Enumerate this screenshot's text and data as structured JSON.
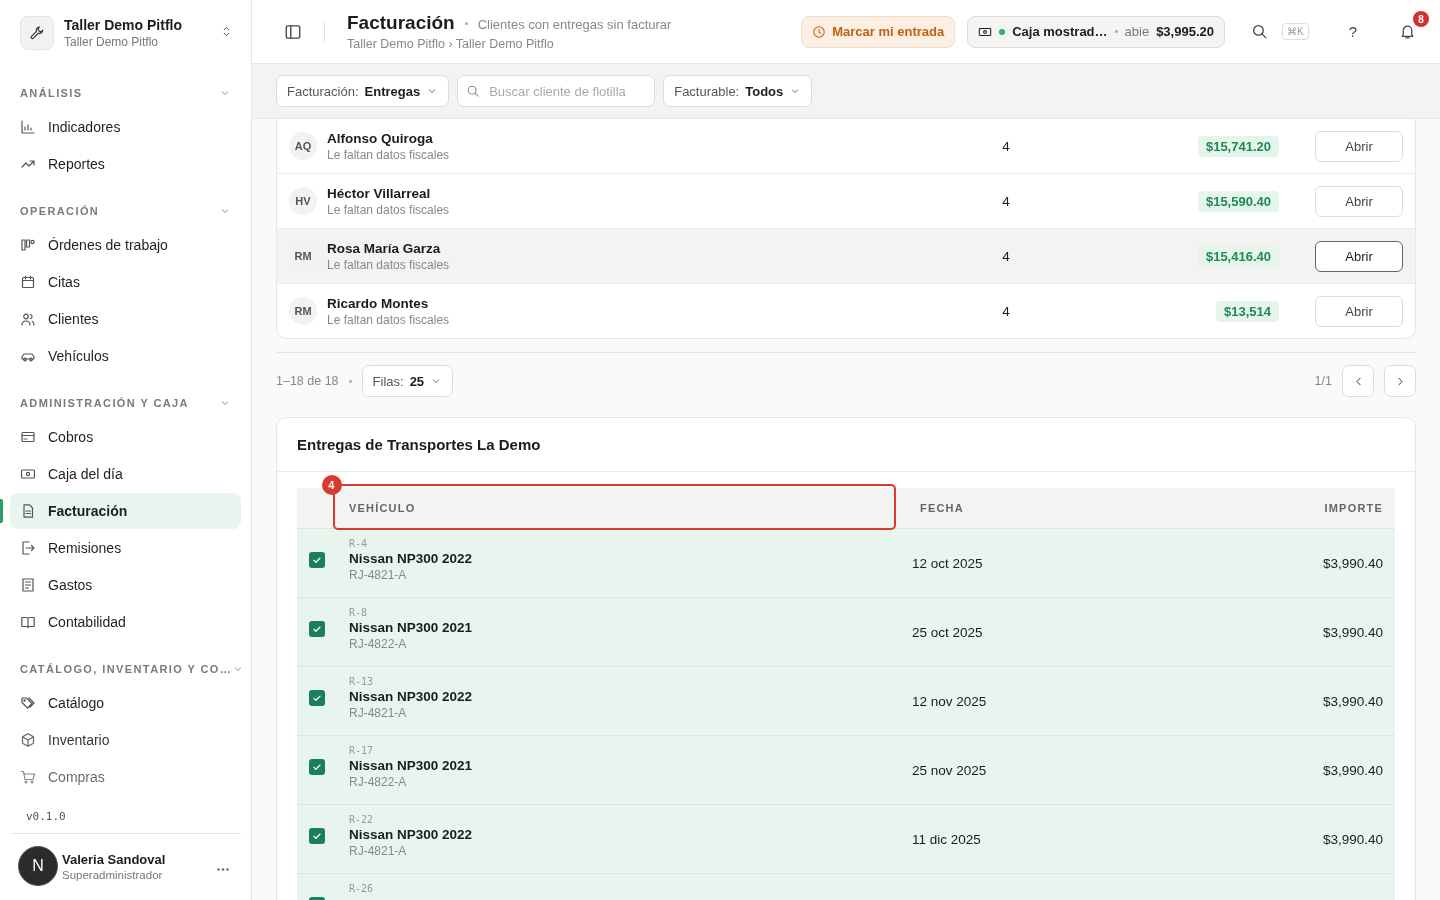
{
  "sidebar": {
    "workspace": {
      "name": "Taller Demo Pitflo",
      "subtitle": "Taller Demo Pitflo"
    },
    "sections": [
      {
        "label": "ANÁLISIS",
        "expanded": true,
        "items": [
          {
            "label": "Indicadores",
            "selected": false
          },
          {
            "label": "Reportes",
            "selected": false
          }
        ]
      },
      {
        "label": "OPERACIÓN",
        "expanded": true,
        "items": [
          {
            "label": "Órdenes de trabajo",
            "selected": false
          },
          {
            "label": "Citas",
            "selected": false
          },
          {
            "label": "Clientes",
            "selected": false
          },
          {
            "label": "Vehículos",
            "selected": false
          }
        ]
      },
      {
        "label": "ADMINISTRACIÓN Y CAJA",
        "expanded": true,
        "items": [
          {
            "label": "Cobros",
            "selected": false
          },
          {
            "label": "Caja del día",
            "selected": false
          },
          {
            "label": "Facturación",
            "selected": true
          },
          {
            "label": "Remisiones",
            "selected": false
          },
          {
            "label": "Gastos",
            "selected": false
          },
          {
            "label": "Contabilidad",
            "selected": false
          }
        ]
      },
      {
        "label": "CATÁLOGO, INVENTARIO Y CO…",
        "expanded": true,
        "items": [
          {
            "label": "Catálogo",
            "selected": false
          },
          {
            "label": "Inventario",
            "selected": false
          },
          {
            "label": "Compras",
            "selected": false
          }
        ]
      }
    ],
    "version": "v0.1.0",
    "user": {
      "initial": "N",
      "name": "Valeria Sandoval",
      "role": "Superadministrador"
    }
  },
  "header": {
    "title": "Facturación",
    "subtitle": "Clientes con entregas sin facturar",
    "breadcrumb": "Taller Demo Pitflo › Taller Demo Pitflo",
    "clock_in_button": "Marcar mi entrada",
    "register": {
      "name": "Caja mostrad…",
      "open": true,
      "status": "abie",
      "amount": "$3,995.20"
    },
    "shortcut": "⌘K",
    "help": "?",
    "notifications": "8"
  },
  "filters": {
    "billing": {
      "label": "Facturación:",
      "value": "Entregas"
    },
    "search": {
      "placeholder": "Buscar cliente de flotilla"
    },
    "billable": {
      "label": "Facturable:",
      "value": "Todos"
    }
  },
  "clients": [
    {
      "initials": "AQ",
      "name": "Alfonso Quiroga",
      "note": "Le faltan datos fiscales",
      "count": "4",
      "amount": "$15,741.20",
      "action": "Abrir",
      "hovered": false
    },
    {
      "initials": "HV",
      "name": "Héctor Villarreal",
      "note": "Le faltan datos fiscales",
      "count": "4",
      "amount": "$15,590.40",
      "action": "Abrir",
      "hovered": false
    },
    {
      "initials": "RM",
      "name": "Rosa María Garza",
      "note": "Le faltan datos fiscales",
      "count": "4",
      "amount": "$15,416.40",
      "action": "Abrir",
      "hovered": true
    },
    {
      "initials": "RM",
      "name": "Ricardo Montes",
      "note": "Le faltan datos fiscales",
      "count": "4",
      "amount": "$13,514",
      "action": "Abrir",
      "hovered": false
    }
  ],
  "pagination": {
    "range": "1–18 de 18",
    "rows_label": "Filas:",
    "rows_value": "25",
    "page": "1/1"
  },
  "deliveries": {
    "title": "Entregas de Transportes La Demo",
    "columns": [
      "VEHÍCULO",
      "FECHA",
      "IMPORTE"
    ],
    "highlight": {
      "badge": "4"
    },
    "rows": [
      {
        "code": "R-4",
        "vehicle": "Nissan NP300 2022",
        "plate": "RJ-4821-A",
        "date": "12 oct 2025",
        "amount": "$3,990.40",
        "checked": true
      },
      {
        "code": "R-8",
        "vehicle": "Nissan NP300 2021",
        "plate": "RJ-4822-A",
        "date": "25 oct 2025",
        "amount": "$3,990.40",
        "checked": true
      },
      {
        "code": "R-13",
        "vehicle": "Nissan NP300 2022",
        "plate": "RJ-4821-A",
        "date": "12 nov 2025",
        "amount": "$3,990.40",
        "checked": true
      },
      {
        "code": "R-17",
        "vehicle": "Nissan NP300 2021",
        "plate": "RJ-4822-A",
        "date": "25 nov 2025",
        "amount": "$3,990.40",
        "checked": true
      },
      {
        "code": "R-22",
        "vehicle": "Nissan NP300 2022",
        "plate": "RJ-4821-A",
        "date": "11 dic 2025",
        "amount": "$3,990.40",
        "checked": true
      },
      {
        "code": "R-26",
        "checked": true
      }
    ]
  }
}
